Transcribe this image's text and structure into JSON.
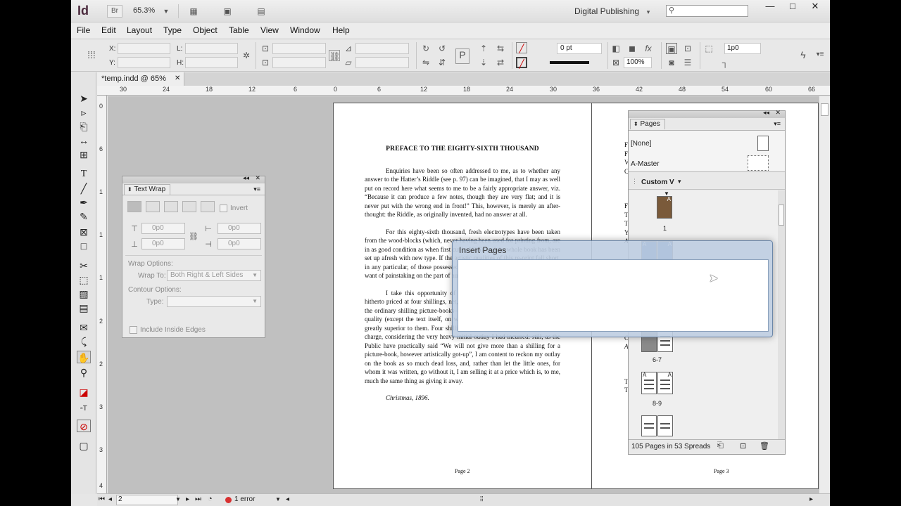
{
  "app": {
    "logo": "Id",
    "bridge_label": "Br",
    "zoom": "65.3%",
    "workspace": "Digital Publishing",
    "win_min": "—",
    "win_max": "□",
    "win_close": "✕"
  },
  "menu": [
    "File",
    "Edit",
    "Layout",
    "Type",
    "Object",
    "Table",
    "View",
    "Window",
    "Help"
  ],
  "control": {
    "x_label": "X:",
    "y_label": "Y:",
    "l_label": "L:",
    "h_label": "H:",
    "stroke_weight": "0 pt",
    "scale": "100%",
    "gap": "1p0"
  },
  "doc_tab": {
    "title": "*temp.indd @ 65%",
    "close": "✕"
  },
  "ruler_labels": [
    "30",
    "24",
    "18",
    "12",
    "6",
    "0",
    "6",
    "12",
    "18",
    "24",
    "30",
    "36",
    "42",
    "48",
    "54",
    "60",
    "66"
  ],
  "vruler_labels": [
    "0",
    "6",
    "1",
    "1",
    "1",
    "2",
    "2",
    "3",
    "3",
    "4"
  ],
  "page_left": {
    "heading": "PREFACE TO THE EIGHTY-SIXTH THOUSAND",
    "paragraphs": [
      "Enquiries have been so often addressed to me, as to whether any answer to the Hatter’s Riddle (see p. 97) can be imagined, that I may as well put on record here what seems to me to be a fairly appropriate answer, viz. “Because it can produce a few notes, though they are very flat; and it is never put with the wrong end in front!” This, however, is merely an after-thought: the Riddle, as originally invented, had no answer at all.",
      "For this eighty-sixth thousand, fresh electrotypes have been taken from the wood-blocks (which, never having been used for printing from, are in as good condition as when first cut in 1865), and the whole book has been set up afresh with new type. If the artistic qualities of this re-print fall short, in any particular, of those possessed by the original issue, it will not be for want of painstaking on the part of author, publisher, or printer.",
      "I take this opportunity of announcing that the Nursery “Alice,” hitherto priced at four shillings, net, is now to be had on the same terms as the ordinary shilling picture-books—although I feel sure that it is, in every quality (except the text itself, on which I am not qualified to pronounce), greatly superior to them. Four shillings was a perfectly reasonable price to charge, considering the very heavy initial outlay I had incurred: still, as the Public have practically said “We will not give more than a shilling for a picture-book, however artistically got-up”, I am content to reckon my outlay on the book as so much dead loss, and, rather than let the little ones, for whom it was written, go without it, I am selling it at a price which is, to me, much the same thing as giving it away.",
      "Christmas, 1896."
    ],
    "page_number": "Page 2"
  },
  "page_right": {
    "page_number": "Page 3",
    "edge_letters": [
      "F",
      "F",
      "V",
      "C",
      "F",
      "T",
      "T",
      "Y",
      "A",
      "I",
      "T",
      "C",
      "A",
      "T",
      "T"
    ]
  },
  "text_wrap_panel": {
    "tab": "Text Wrap",
    "invert": "Invert",
    "top_offset": "0p0",
    "left_offset": "0p0",
    "bottom_offset": "0p0",
    "right_offset": "0p0",
    "wrap_options": "Wrap Options:",
    "wrap_to_label": "Wrap To:",
    "wrap_to_value": "Both Right & Left Sides",
    "contour_options": "Contour Options:",
    "type_label": "Type:",
    "include_inside_edges": "Include Inside Edges"
  },
  "pages_panel": {
    "tab": "Pages",
    "master_none": "[None]",
    "master_a": "A-Master",
    "view_menu": "Custom V",
    "thumb_labels": [
      "1",
      "6-7",
      "8-9"
    ],
    "master_marker": "A",
    "footer": "105 Pages in 53 Spreads"
  },
  "dialog": {
    "title": "Insert Pages"
  },
  "status": {
    "page": "2",
    "error": "1 error"
  }
}
